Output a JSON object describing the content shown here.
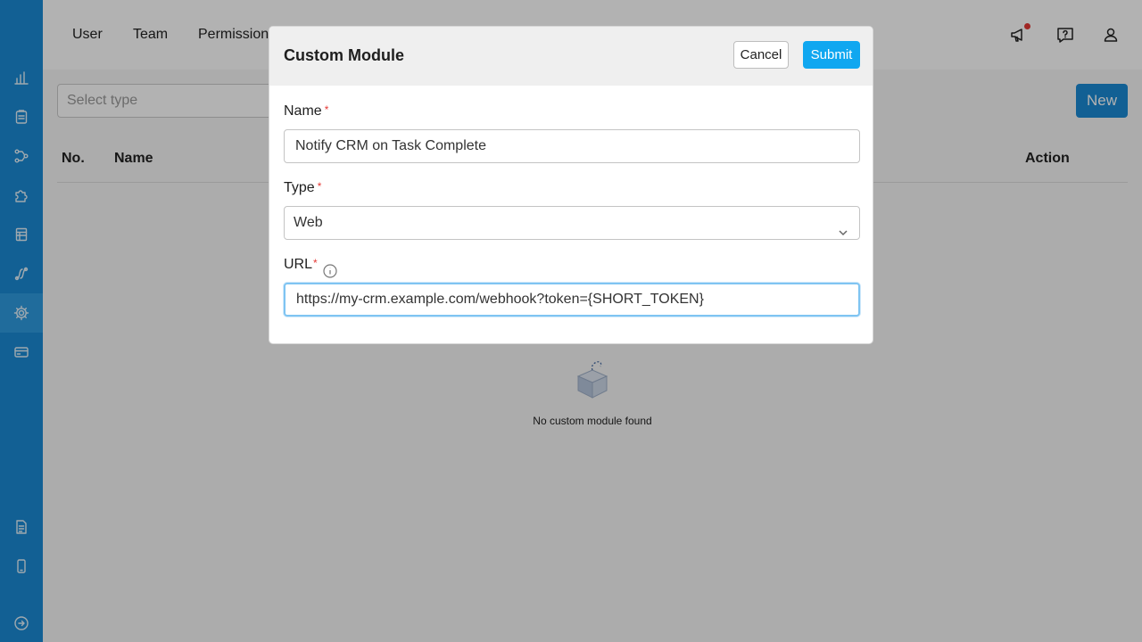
{
  "sidebar": {
    "items": [
      {
        "icon": "chart-icon"
      },
      {
        "icon": "clipboard-icon"
      },
      {
        "icon": "flow-icon"
      },
      {
        "icon": "puzzle-icon"
      },
      {
        "icon": "table-icon"
      },
      {
        "icon": "integration-icon"
      },
      {
        "icon": "gear-icon",
        "active": true
      },
      {
        "icon": "credit-card-icon"
      },
      {
        "icon": "document-icon"
      },
      {
        "icon": "mobile-icon"
      },
      {
        "icon": "logout-icon"
      }
    ]
  },
  "top_nav": {
    "tabs": [
      "User",
      "Team",
      "Permission"
    ],
    "icons": [
      "megaphone-icon",
      "help-icon",
      "user-icon"
    ]
  },
  "toolbar": {
    "select_placeholder": "Select type",
    "new_label": "New"
  },
  "table": {
    "headers": {
      "no": "No.",
      "name": "Name",
      "action": "Action"
    },
    "empty_text": "No custom module found"
  },
  "modal": {
    "title": "Custom Module",
    "cancel_label": "Cancel",
    "submit_label": "Submit",
    "name_label": "Name",
    "name_value": "Notify CRM on Task Complete",
    "type_label": "Type",
    "type_value": "Web",
    "url_label": "URL",
    "url_value": "https://my-crm.example.com/webhook?token={SHORT_TOKEN}",
    "required_mark": "*"
  },
  "colors": {
    "sidebar": "#1a8ad4",
    "primary_button": "#10a7f0",
    "required": "#e53935"
  }
}
